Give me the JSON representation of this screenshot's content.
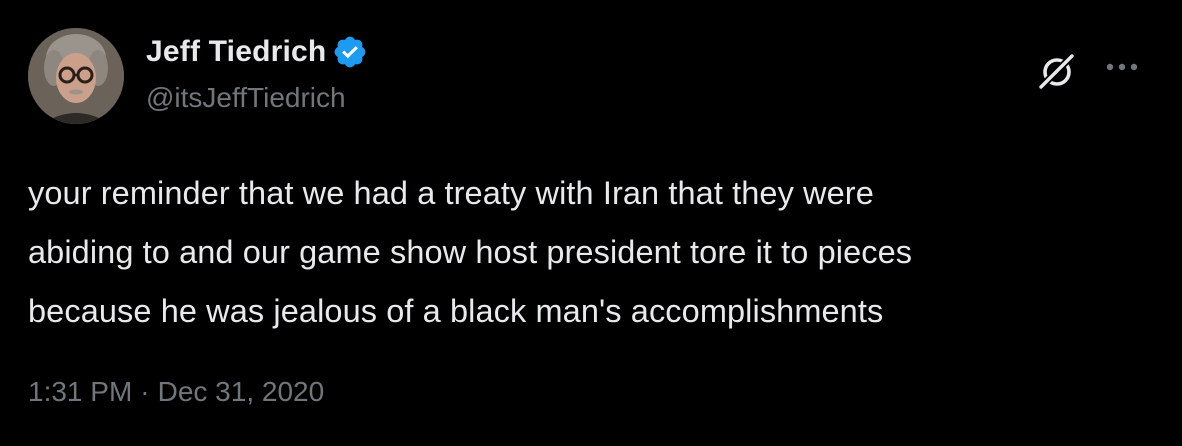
{
  "author": {
    "name": "Jeff Tiedrich",
    "handle": "@itsJeffTiedrich",
    "verified": true,
    "verified_color": "#1d9bf0"
  },
  "tweet": {
    "text": "your reminder that we had a treaty with Iran that they were\nabiding to and our game show host president tore it to pieces\nbecause he was jealous of a black man's accomplishments",
    "time": "1:31 PM",
    "separator": "·",
    "date": "Dec 31, 2020"
  },
  "icons": {
    "grok": "grok-icon",
    "more": "more-horizontal-icon",
    "verified": "verified-badge-icon"
  },
  "colors": {
    "background": "#000000",
    "primary_text": "#e7e9ea",
    "secondary_text": "#71767b"
  }
}
